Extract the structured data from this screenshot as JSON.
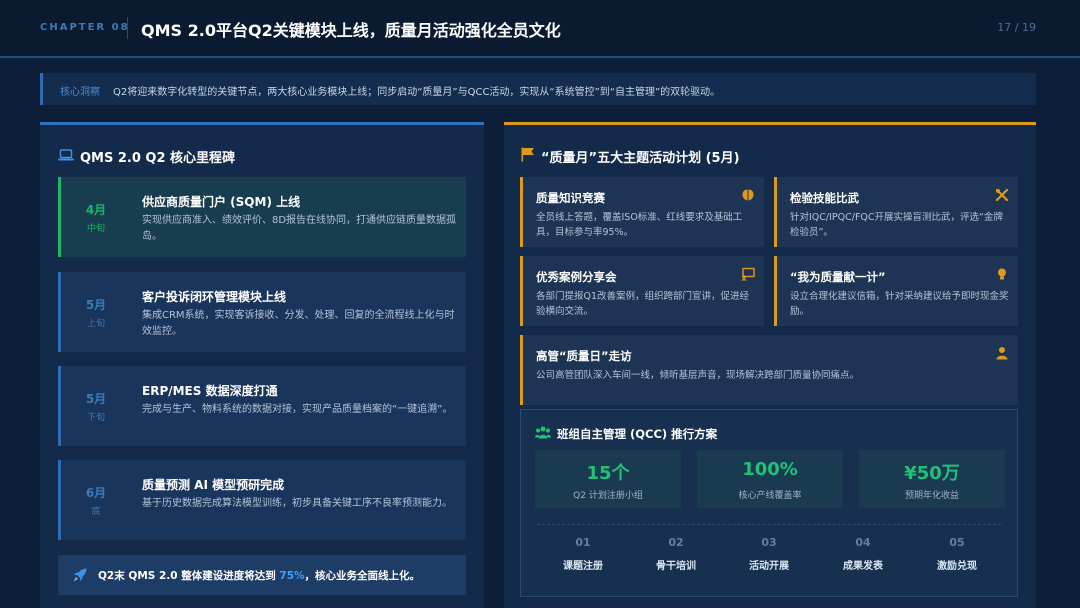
{
  "header": {
    "chapter": "CHAPTER 08",
    "title": "QMS 2.0平台Q2关键模块上线，质量月活动强化全员文化",
    "page": "17 / 19"
  },
  "insight": {
    "tag": "核心洞察",
    "text": "Q2将迎来数字化转型的关键节点，两大核心业务模块上线；同步启动“质量月”与QCC活动，实现从“系统管控”到“自主管理”的双轮驱动。"
  },
  "milestones": {
    "title": "QMS 2.0 Q2 核心里程碑",
    "icon": "laptop-icon",
    "items": [
      {
        "month": "4月",
        "period": "中旬",
        "title": "供应商质量门户 (SQM) 上线",
        "desc": "实现供应商准入、绩效评价、8D报告在线协同，打通供应链质量数据孤岛。"
      },
      {
        "month": "5月",
        "period": "上旬",
        "title": "客户投诉闭环管理模块上线",
        "desc": "集成CRM系统，实现客诉接收、分发、处理、回复的全流程线上化与时效监控。"
      },
      {
        "month": "5月",
        "period": "下旬",
        "title": "ERP/MES 数据深度打通",
        "desc": "完成与生产、物料系统的数据对接，实现产品质量档案的“一键追溯”。"
      },
      {
        "month": "6月",
        "period": "底",
        "title": "质量预测 AI 模型预研完成",
        "desc": "基于历史数据完成算法模型训练，初步具备关键工序不良率预测能力。"
      }
    ],
    "progress": {
      "before": "Q2末 QMS 2.0 整体建设进度将达到 ",
      "value": "75%",
      "after": "，核心业务全面线上化。",
      "percent": 75
    }
  },
  "activities": {
    "title": "“质量月”五大主题活动计划 (5月)",
    "icon": "flag-icon",
    "cards": [
      {
        "title": "质量知识竞赛",
        "desc": "全员线上答题，覆盖ISO标准、红线要求及基础工具，目标参与率95%。",
        "icon": "brain-icon"
      },
      {
        "title": "检验技能比武",
        "desc": "针对IQC/IPQC/FQC开展实操盲测比武，评选“金牌检验员”。",
        "icon": "tools-icon"
      },
      {
        "title": "优秀案例分享会",
        "desc": "各部门提报Q1改善案例，组织跨部门宣讲，促进经验横向交流。",
        "icon": "presentation-icon"
      },
      {
        "title": "“我为质量献一计”",
        "desc": "设立合理化建议信箱，针对采纳建议给予即时现金奖励。",
        "icon": "lightbulb-icon"
      },
      {
        "title": "高管“质量日”走访",
        "desc": "公司高管团队深入车间一线，倾听基层声音，现场解决跨部门质量协同痛点。",
        "icon": "user-tie-icon"
      }
    ]
  },
  "qcc": {
    "title": "班组自主管理 (QCC) 推行方案",
    "icon": "team-icon",
    "stats": [
      {
        "value": "15个",
        "label": "Q2 计划注册小组"
      },
      {
        "value": "100%",
        "label": "核心产线覆盖率"
      },
      {
        "value": "¥50万",
        "label": "预期年化收益"
      }
    ],
    "steps": [
      {
        "no": "01",
        "label": "课题注册"
      },
      {
        "no": "02",
        "label": "骨干培训"
      },
      {
        "no": "03",
        "label": "活动开展"
      },
      {
        "no": "04",
        "label": "成果发表"
      },
      {
        "no": "05",
        "label": "激励兑现"
      }
    ]
  },
  "colors": {
    "background": "#0c1e38",
    "accent_blue": "#2f74c0",
    "accent_orange": "#e09a1a",
    "accent_green": "#1db56a"
  }
}
